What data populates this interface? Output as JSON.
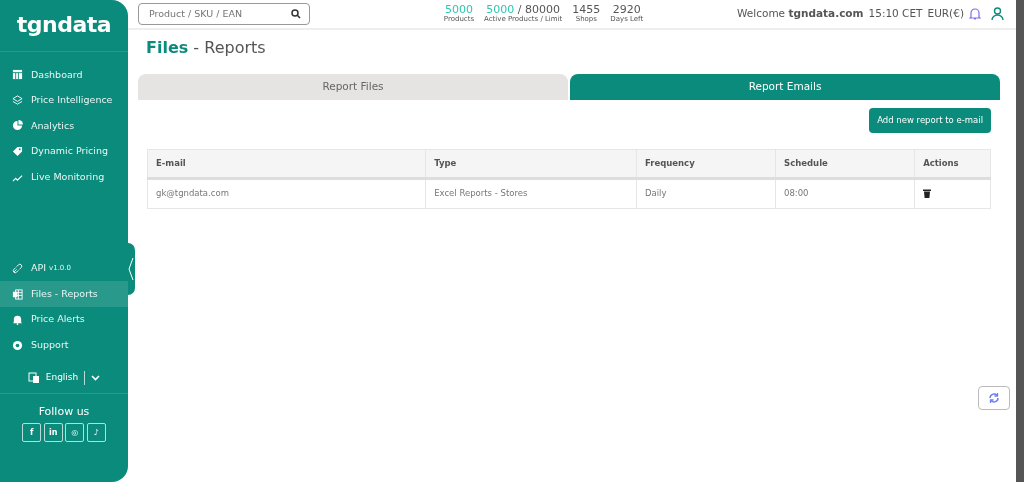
{
  "sidebar": {
    "logo": "tgndata",
    "items": [
      {
        "label": "Dashboard",
        "selected": false
      },
      {
        "label": "Price Intelligence",
        "selected": false
      },
      {
        "label": "Analytics",
        "selected": false
      },
      {
        "label": "Dynamic Pricing",
        "selected": false
      },
      {
        "label": "Live Monitoring",
        "selected": false
      }
    ],
    "lower_items": [
      {
        "label": "API",
        "version": "v1.0.0",
        "selected": false
      },
      {
        "label": "Files - Reports",
        "selected": true
      },
      {
        "label": "Price Alerts",
        "selected": false
      },
      {
        "label": "Support",
        "selected": false
      }
    ],
    "language": "English",
    "follow_title": "Follow us",
    "socials": [
      {
        "label": "f"
      },
      {
        "label": "in"
      },
      {
        "label": "◎"
      },
      {
        "label": "♪"
      }
    ]
  },
  "header": {
    "search": {
      "placeholder": "Product / SKU / EAN"
    },
    "stats": [
      {
        "value": "5000",
        "highlighted": true,
        "label": "Products"
      },
      {
        "value": "5000",
        "limit": "/ 80000",
        "highlighted": true,
        "label": "Active Products / Limit"
      },
      {
        "value": "1455",
        "highlighted": false,
        "label": "Shops"
      },
      {
        "value": "2920",
        "highlighted": false,
        "label": "Days Left"
      }
    ],
    "welcome": "Welcome **tgndata.com**",
    "time": "15:10 CET",
    "currency": "EUR(€)"
  },
  "page": {
    "title_main": "Files",
    "title_rest": "- Reports",
    "tabs": [
      {
        "label": "Report Files",
        "selected": false
      },
      {
        "label": "Report Emails",
        "selected": true
      }
    ],
    "add_button": "Add new report to e-mail",
    "table": {
      "columns": [
        "E-mail",
        "Type",
        "Frequency",
        "Schedule",
        "Actions"
      ],
      "rows": [
        {
          "cells": [
            "gk@tgndata.com",
            "Excel Reports - Stores",
            "Daily",
            "08:00"
          ]
        }
      ]
    }
  }
}
